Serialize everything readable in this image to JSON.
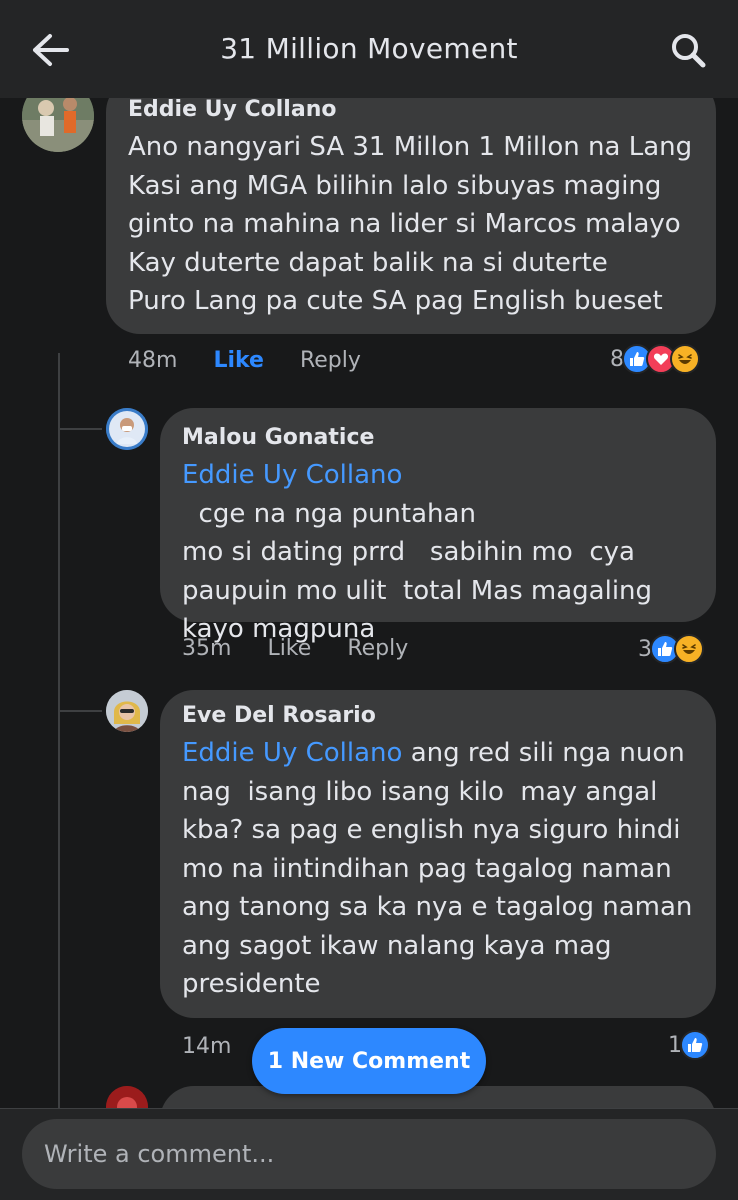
{
  "header": {
    "title": "31 Million Movement"
  },
  "comments": [
    {
      "author": "Eddie Uy Collano",
      "lines": [
        "Ano nangyari SA 31 Millon 1 Millon na Lang",
        "Kasi ang MGA bilihin lalo sibuyas  maging",
        "ginto na  mahina na lider si Marcos malayo",
        "Kay duterte dapat balik na si duterte",
        "Puro Lang pa cute SA pag English  bueset"
      ],
      "time": "48m",
      "like_label": "Like",
      "reply_label": "Reply",
      "reaction_count": "8"
    },
    {
      "author": "Malou Gonatice",
      "mention": "Eddie Uy Collano",
      "first_line_rest": "  cge na nga puntahan",
      "lines": [
        "mo si dating prrd   sabihin mo  cya",
        "paupuin mo ulit  total Mas magaling",
        "kayo magpuna"
      ],
      "time": "35m",
      "like_label": "Like",
      "reply_label": "Reply",
      "reaction_count": "3"
    },
    {
      "author": "Eve Del Rosario",
      "mention": "Eddie Uy Collano",
      "first_line_rest": " ang red sili nga nuon",
      "lines": [
        "nag  isang libo isang kilo  may angal",
        "kba? sa pag e english nya siguro hindi",
        "mo na iintindihan pag tagalog naman",
        "ang tanong sa ka nya e tagalog naman",
        "ang sagot ikaw nalang kaya mag",
        "presidente"
      ],
      "time": "14m",
      "reaction_count": "1"
    }
  ],
  "new_comment_label": "1 New Comment",
  "composer": {
    "placeholder": "Write a comment..."
  },
  "colors": {
    "background": "#18191a",
    "bubble": "#3a3b3c",
    "mention": "#4599ff",
    "like_active": "#2d88ff",
    "reaction_love": "#f33e58",
    "reaction_haha": "#f7b125"
  }
}
